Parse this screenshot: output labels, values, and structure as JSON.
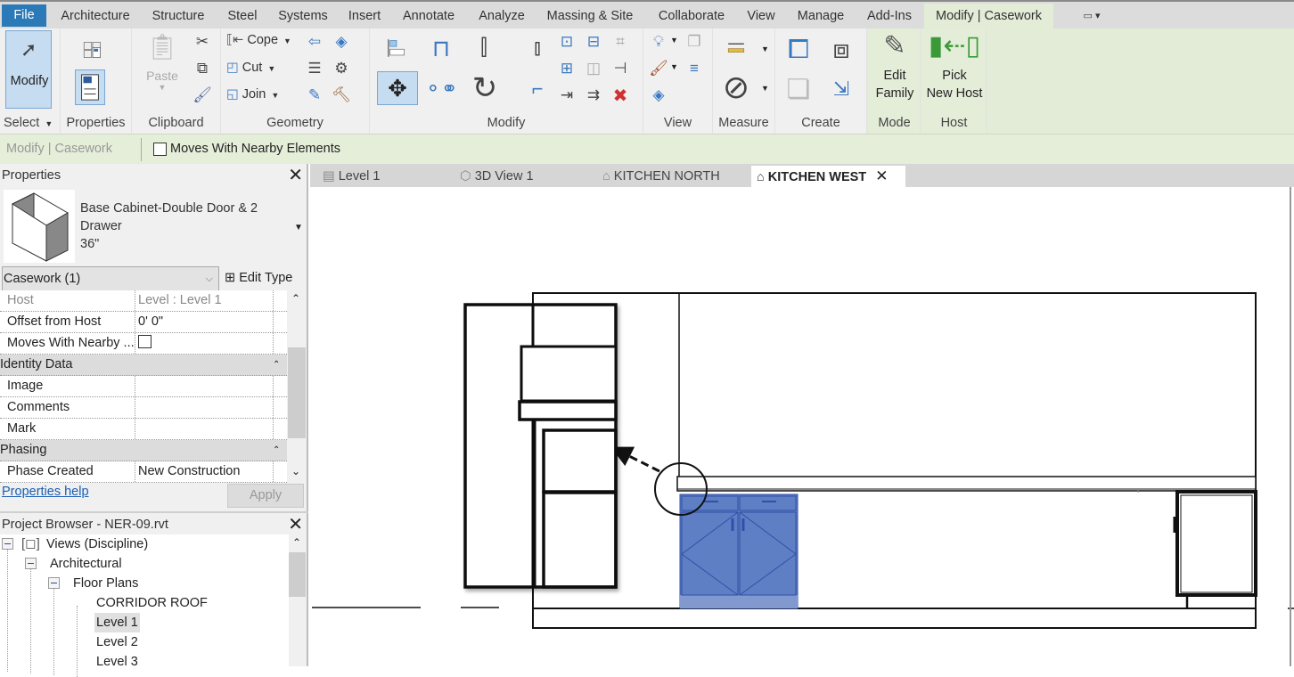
{
  "ribbon_tabs": [
    "File",
    "Architecture",
    "Structure",
    "Steel",
    "Systems",
    "Insert",
    "Annotate",
    "Analyze",
    "Massing & Site",
    "Collaborate",
    "View",
    "Manage",
    "Add-Ins",
    "Modify | Casework"
  ],
  "active_tab": "Modify | Casework",
  "panels": {
    "select": {
      "label": "Select",
      "modify": "Modify"
    },
    "properties": {
      "label": "Properties"
    },
    "clipboard": {
      "label": "Clipboard",
      "paste": "Paste"
    },
    "geometry": {
      "label": "Geometry",
      "cope": "Cope",
      "cut": "Cut",
      "join": "Join"
    },
    "modify": {
      "label": "Modify"
    },
    "view": {
      "label": "View"
    },
    "measure": {
      "label": "Measure"
    },
    "create": {
      "label": "Create"
    },
    "mode": {
      "label": "Mode",
      "edit_family_1": "Edit",
      "edit_family_2": "Family"
    },
    "host": {
      "label": "Host",
      "pick_1": "Pick",
      "pick_2": "New Host"
    }
  },
  "options_bar": {
    "context": "Modify | Casework",
    "moves_with_nearby": "Moves With Nearby Elements",
    "moves_checked": false
  },
  "properties": {
    "title": "Properties",
    "type_name_1": "Base Cabinet-Double Door & 2",
    "type_name_2": "Drawer",
    "type_name_3": "36\"",
    "category": "Casework (1)",
    "edit_type": "Edit Type",
    "rows": [
      {
        "label": "Host",
        "value": "Level : Level 1"
      },
      {
        "label": "Offset from Host",
        "value": "0'  0\""
      },
      {
        "label": "Moves With Nearby ...",
        "value": ""
      },
      {
        "group": "Identity Data"
      },
      {
        "label": "Image",
        "value": ""
      },
      {
        "label": "Comments",
        "value": ""
      },
      {
        "label": "Mark",
        "value": ""
      },
      {
        "group": "Phasing"
      },
      {
        "label": "Phase Created",
        "value": "New Construction"
      }
    ],
    "help": "Properties help",
    "apply": "Apply"
  },
  "project_browser": {
    "title": "Project Browser - NER-09.rvt",
    "items": [
      "Views (Discipline)",
      "Architectural",
      "Floor Plans",
      "CORRIDOR ROOF",
      "Level 1",
      "Level 2",
      "Level 3"
    ],
    "selected": "Level 1"
  },
  "view_tabs": [
    {
      "label": "Level 1",
      "icon": "floor-plan-icon"
    },
    {
      "label": "3D View 1",
      "icon": "3d-view-icon"
    },
    {
      "label": "KITCHEN NORTH",
      "icon": "elevation-icon"
    },
    {
      "label": "KITCHEN WEST",
      "icon": "elevation-icon",
      "active": true
    }
  ],
  "colors": {
    "file_tab": "#2b79b7",
    "selection": "#5f7fc4",
    "context_green": "#e4edd8"
  }
}
